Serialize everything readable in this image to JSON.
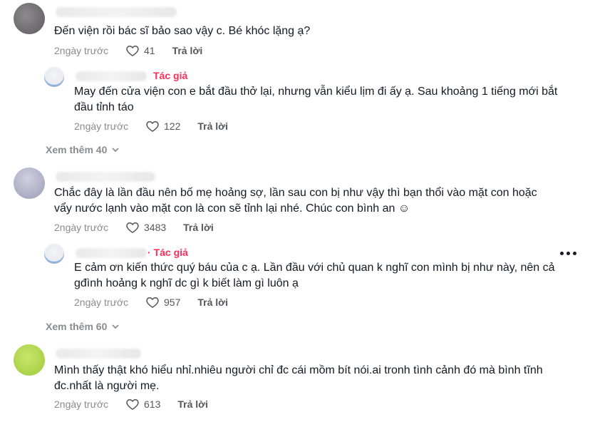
{
  "comments": [
    {
      "text": "Đến viện rồi bác sĩ bảo sao vậy c. Bé khóc lặng ạ?",
      "date": "2ngày trước",
      "likes": "41",
      "reply": "Trả lời",
      "reply_thread": {
        "badge": "Tác giả",
        "text": "May đến cửa viện con e bắt đầu thở lại, nhưng vẫn kiểu lịm đi ấy ạ. Sau khoảng 1 tiếng mới bắt đầu tỉnh táo",
        "date": "2ngày trước",
        "likes": "122",
        "reply": "Trả lời"
      },
      "see_more": "Xem thêm 40"
    },
    {
      "text": "Chắc đây là lần đầu nên bố mẹ hoảng sợ, lần sau con bị như vậy thì bạn thổi vào mặt con hoặc vẩy nước lạnh vào mặt con là con sẽ tỉnh lại nhé. Chúc con bình an ☺",
      "date": "2ngày trước",
      "likes": "3483",
      "reply": "Trả lời",
      "reply_thread": {
        "badge": "· Tác giả",
        "text": "E cảm ơn kiến thức quý báu của c ạ. Lần đầu với chủ quan k nghĩ con mình bị như này, nên cả gđình hoảng k nghĩ dc gì k biết làm gì luôn ạ",
        "date": "2ngày trước",
        "likes": "957",
        "reply": "Trả lời"
      },
      "see_more": "Xem thêm 60"
    },
    {
      "text": "Mình thấy thật khó hiểu nhỉ.nhiêu người chỉ đc cái mồm bít nói.ai tronh tình cảnh đó mà bình tĩnh đc.nhất là người mẹ.",
      "date": "2ngày trước",
      "likes": "613",
      "reply": "Trả lời"
    }
  ],
  "icons": {
    "like": "heart-outline-icon",
    "expand": "chevron-down-icon",
    "more": "more-options-icon"
  },
  "colors": {
    "author_badge": "#fe2c55",
    "meta": "#8a8b91"
  }
}
